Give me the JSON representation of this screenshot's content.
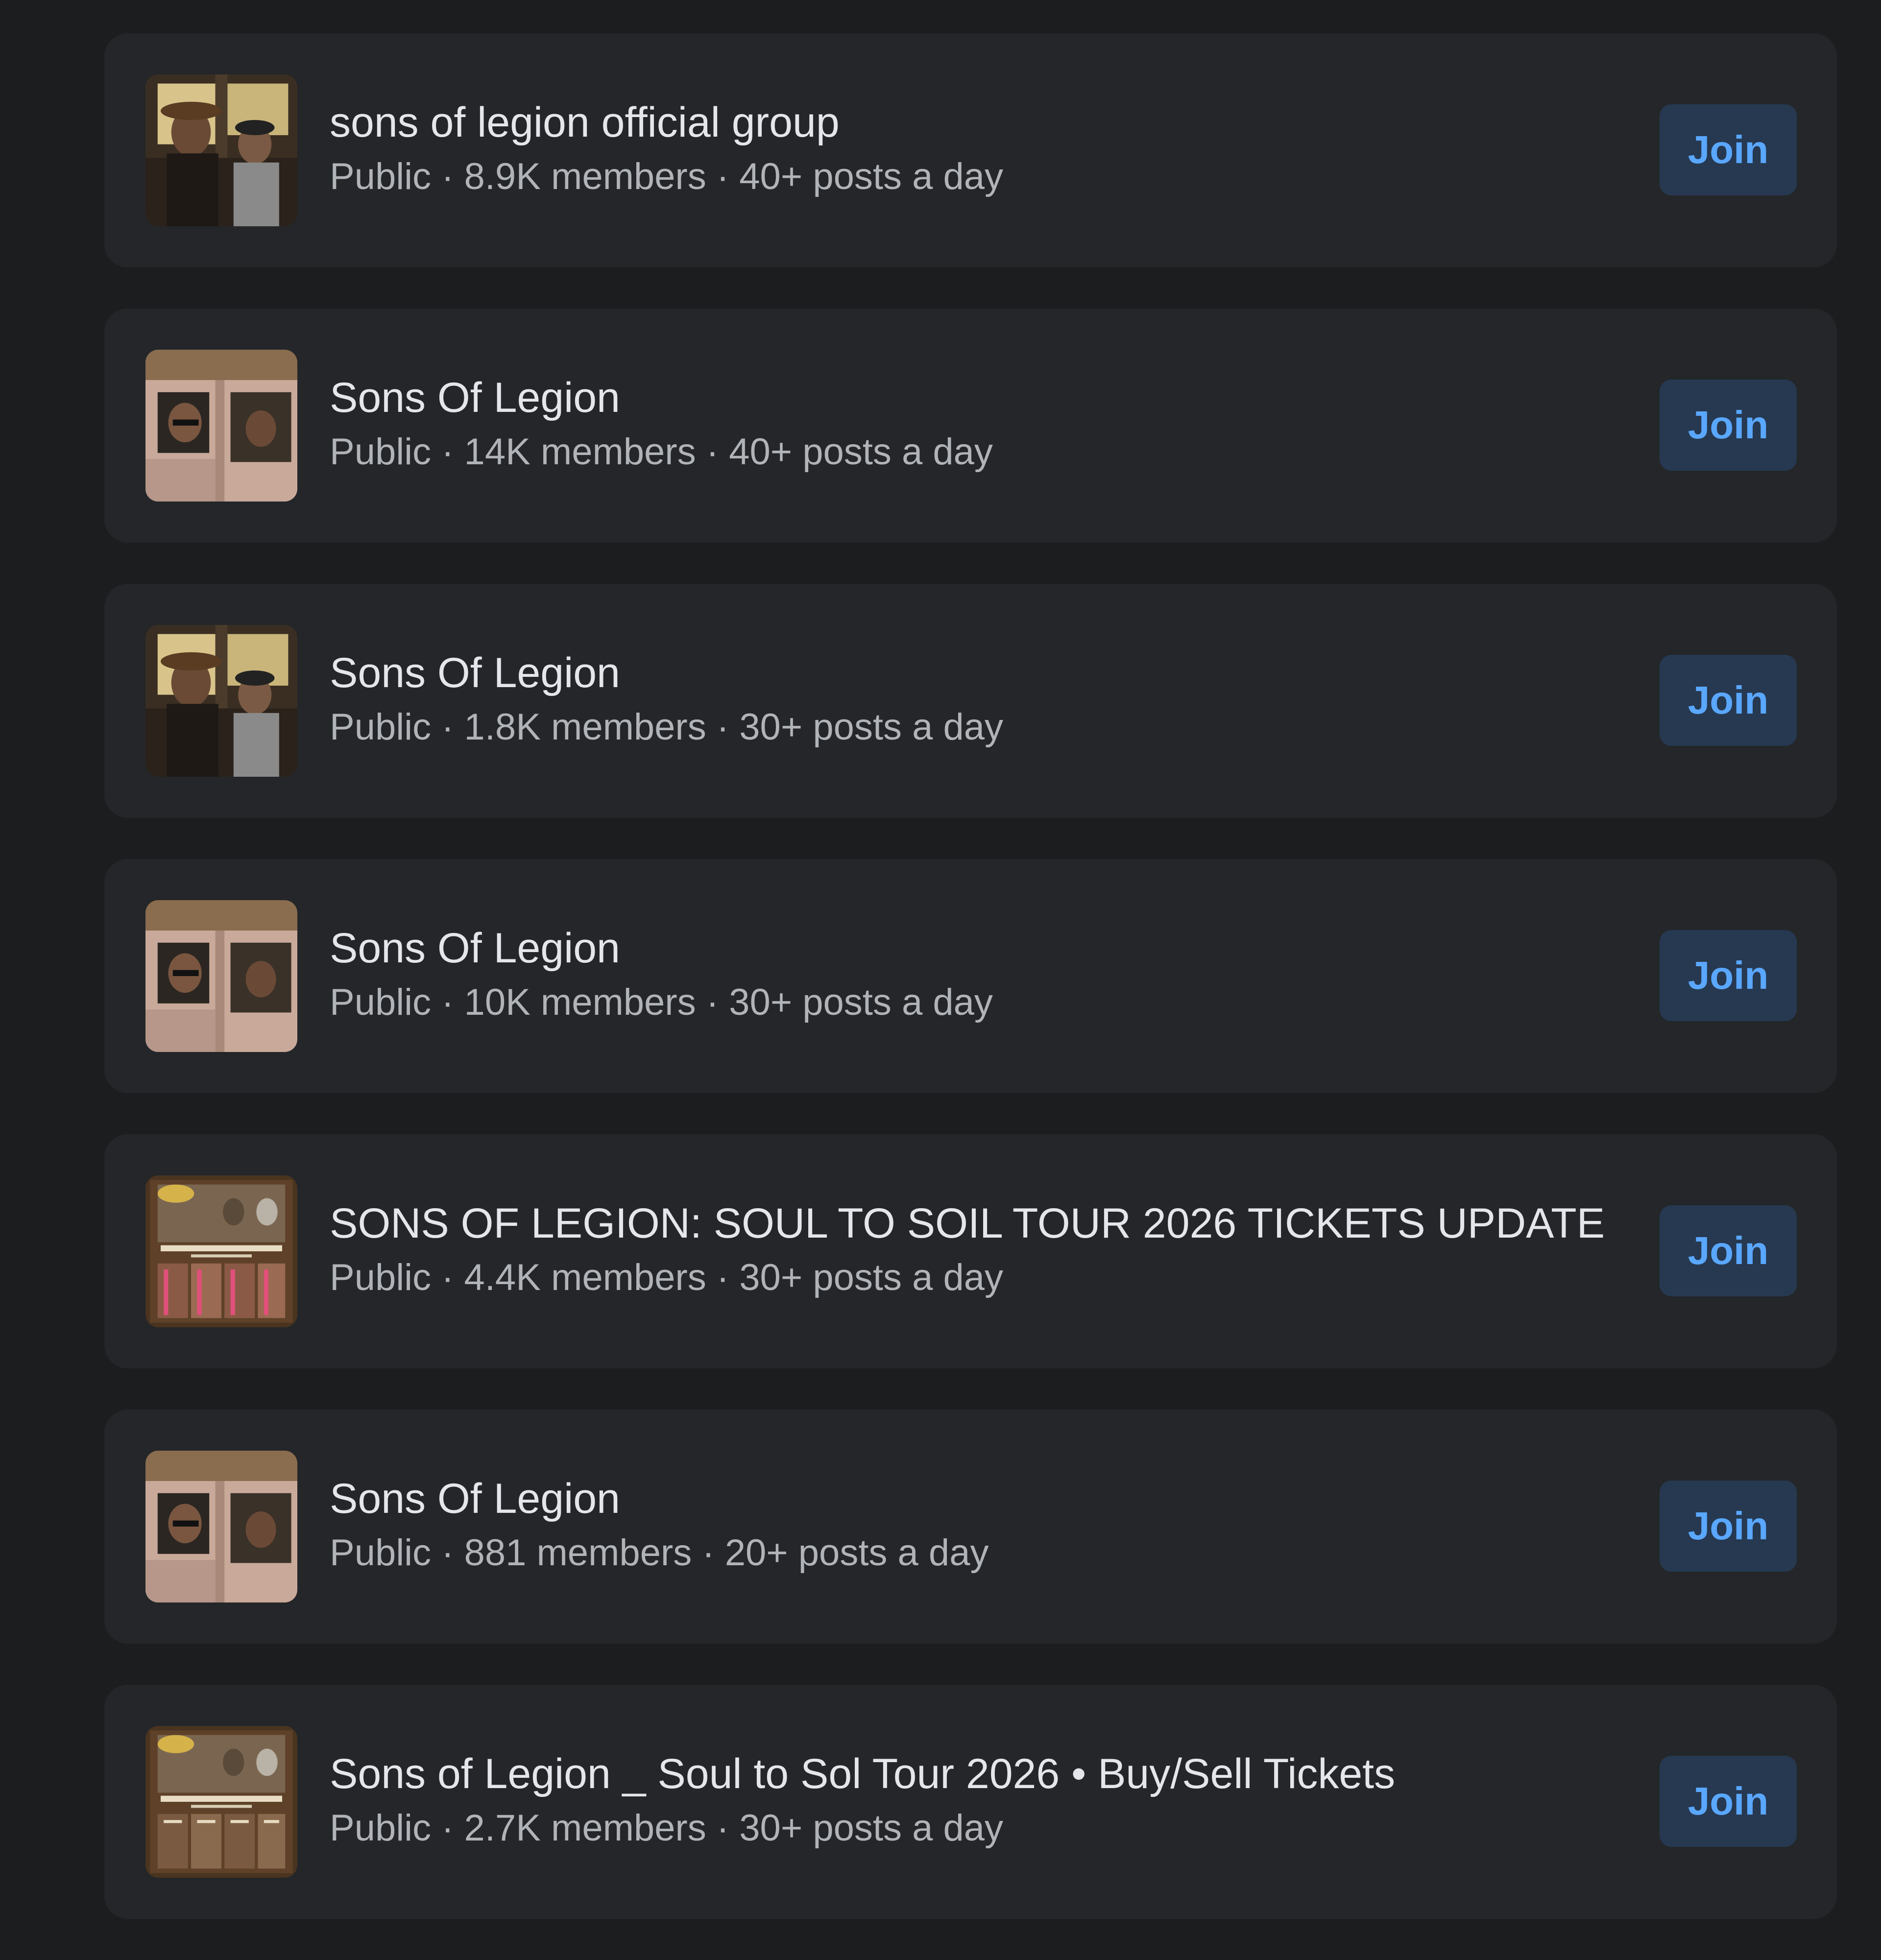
{
  "join_label": "Join",
  "separator": " · ",
  "groups": [
    {
      "name": "sons of legion official group",
      "privacy": "Public",
      "members": "8.9K members",
      "activity": "40+ posts a day",
      "thumb": "band-window-photo"
    },
    {
      "name": "Sons Of Legion",
      "privacy": "Public",
      "members": "14K members",
      "activity": "40+ posts a day",
      "thumb": "band-car-photo"
    },
    {
      "name": "Sons Of Legion",
      "privacy": "Public",
      "members": "1.8K members",
      "activity": "30+ posts a day",
      "thumb": "band-window-photo"
    },
    {
      "name": "Sons Of Legion",
      "privacy": "Public",
      "members": "10K members",
      "activity": "30+ posts a day",
      "thumb": "band-car-photo"
    },
    {
      "name": "SONS OF LEGION: SOUL TO SOIL TOUR 2026 TICKETS UPDATE",
      "privacy": "Public",
      "members": "4.4K members",
      "activity": "30+ posts a day",
      "thumb": "tour-poster"
    },
    {
      "name": "Sons Of Legion",
      "privacy": "Public",
      "members": "881 members",
      "activity": "20+ posts a day",
      "thumb": "band-car-photo"
    },
    {
      "name": "Sons of Legion _ Soul to Sol Tour 2026 • Buy/Sell Tickets",
      "privacy": "Public",
      "members": "2.7K members",
      "activity": "30+ posts a day",
      "thumb": "tour-poster"
    }
  ],
  "colors": {
    "background": "#1c1d1f",
    "card": "#242629",
    "title_text": "#e4e6eb",
    "meta_text": "#b0b3b8",
    "button_bg": "#263951",
    "button_text": "#5aa7ff"
  }
}
